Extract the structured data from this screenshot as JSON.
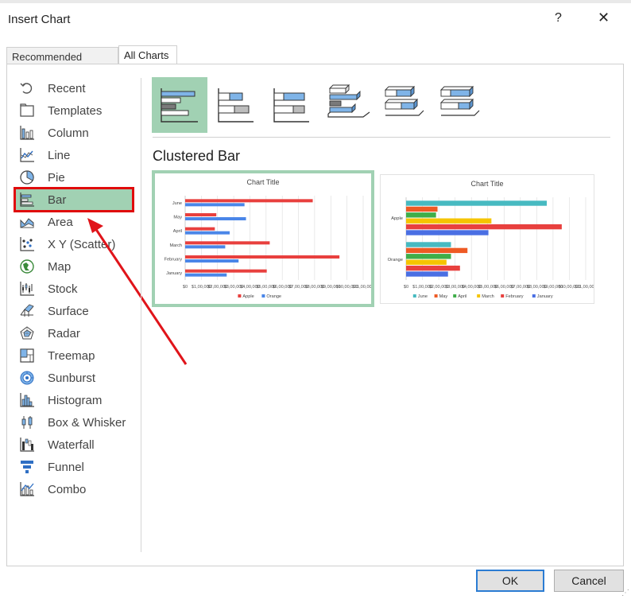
{
  "dialog": {
    "title": "Insert Chart",
    "help": "?",
    "close": "✕"
  },
  "tabs": [
    "Recommended Charts",
    "All Charts"
  ],
  "sidebar": {
    "items": [
      {
        "label": "Recent",
        "icon": "recent-icon"
      },
      {
        "label": "Templates",
        "icon": "templates-icon"
      },
      {
        "label": "Column",
        "icon": "column-chart-icon"
      },
      {
        "label": "Line",
        "icon": "line-chart-icon"
      },
      {
        "label": "Pie",
        "icon": "pie-chart-icon"
      },
      {
        "label": "Bar",
        "icon": "bar-chart-icon",
        "selected": true
      },
      {
        "label": "Area",
        "icon": "area-chart-icon"
      },
      {
        "label": "X Y (Scatter)",
        "icon": "scatter-chart-icon"
      },
      {
        "label": "Map",
        "icon": "map-chart-icon"
      },
      {
        "label": "Stock",
        "icon": "stock-chart-icon"
      },
      {
        "label": "Surface",
        "icon": "surface-chart-icon"
      },
      {
        "label": "Radar",
        "icon": "radar-chart-icon"
      },
      {
        "label": "Treemap",
        "icon": "treemap-chart-icon"
      },
      {
        "label": "Sunburst",
        "icon": "sunburst-chart-icon"
      },
      {
        "label": "Histogram",
        "icon": "histogram-chart-icon"
      },
      {
        "label": "Box & Whisker",
        "icon": "box-whisker-chart-icon"
      },
      {
        "label": "Waterfall",
        "icon": "waterfall-chart-icon"
      },
      {
        "label": "Funnel",
        "icon": "funnel-chart-icon"
      },
      {
        "label": "Combo",
        "icon": "combo-chart-icon"
      }
    ]
  },
  "main": {
    "heading": "Clustered Bar",
    "subtypes": [
      "clustered-bar-icon",
      "stacked-bar-icon",
      "100-stacked-bar-icon",
      "3d-clustered-bar-icon",
      "3d-stacked-bar-icon",
      "3d-100-stacked-bar-icon"
    ]
  },
  "buttons": {
    "ok": "OK",
    "cancel": "Cancel"
  },
  "colors": {
    "selection": "#a1d1b3",
    "highlight_box": "#e00b0b",
    "apple": "#e8403e",
    "orange": "#4a86e8",
    "june": "#47bac1",
    "may": "#ee5a24",
    "april": "#3fae49",
    "march": "#f5c400",
    "february": "#e8403e",
    "january": "#4a6fe3"
  },
  "chart_data": [
    {
      "type": "bar",
      "title": "Chart Title",
      "categories": [
        "January",
        "February",
        "March",
        "April",
        "May",
        "June"
      ],
      "series": [
        {
          "name": "Apple",
          "values": [
            550000,
            1040000,
            570000,
            200000,
            210000,
            860000
          ]
        },
        {
          "name": "Orange",
          "values": [
            280000,
            360000,
            270000,
            300000,
            410000,
            400000
          ]
        }
      ],
      "xticks": [
        "$0",
        "$1,00,000",
        "$2,00,000",
        "$3,00,000",
        "$4,00,000",
        "$5,00,000",
        "$6,00,000",
        "$7,00,000",
        "$8,00,000",
        "$9,00,000",
        "$10,00,000",
        "$11,00,000"
      ],
      "xlim": [
        0,
        1200000
      ],
      "legend": "bottom",
      "grid": true
    },
    {
      "type": "bar",
      "title": "Chart Title",
      "categories": [
        "Orange",
        "Apple"
      ],
      "series": [
        {
          "name": "June",
          "values": [
            300000,
            940000
          ]
        },
        {
          "name": "May",
          "values": [
            410000,
            210000
          ]
        },
        {
          "name": "April",
          "values": [
            300000,
            200000
          ]
        },
        {
          "name": "March",
          "values": [
            270000,
            570000
          ]
        },
        {
          "name": "February",
          "values": [
            360000,
            1040000
          ]
        },
        {
          "name": "January",
          "values": [
            280000,
            550000
          ]
        }
      ],
      "xticks": [
        "$0",
        "$1,00,000",
        "$2,00,000",
        "$3,00,000",
        "$4,00,000",
        "$5,00,000",
        "$6,00,000",
        "$7,00,000",
        "$8,00,000",
        "$9,00,000",
        "$10,00,000",
        "$11,00,000"
      ],
      "xlim": [
        0,
        1200000
      ],
      "legend": "bottom",
      "grid": true
    }
  ]
}
